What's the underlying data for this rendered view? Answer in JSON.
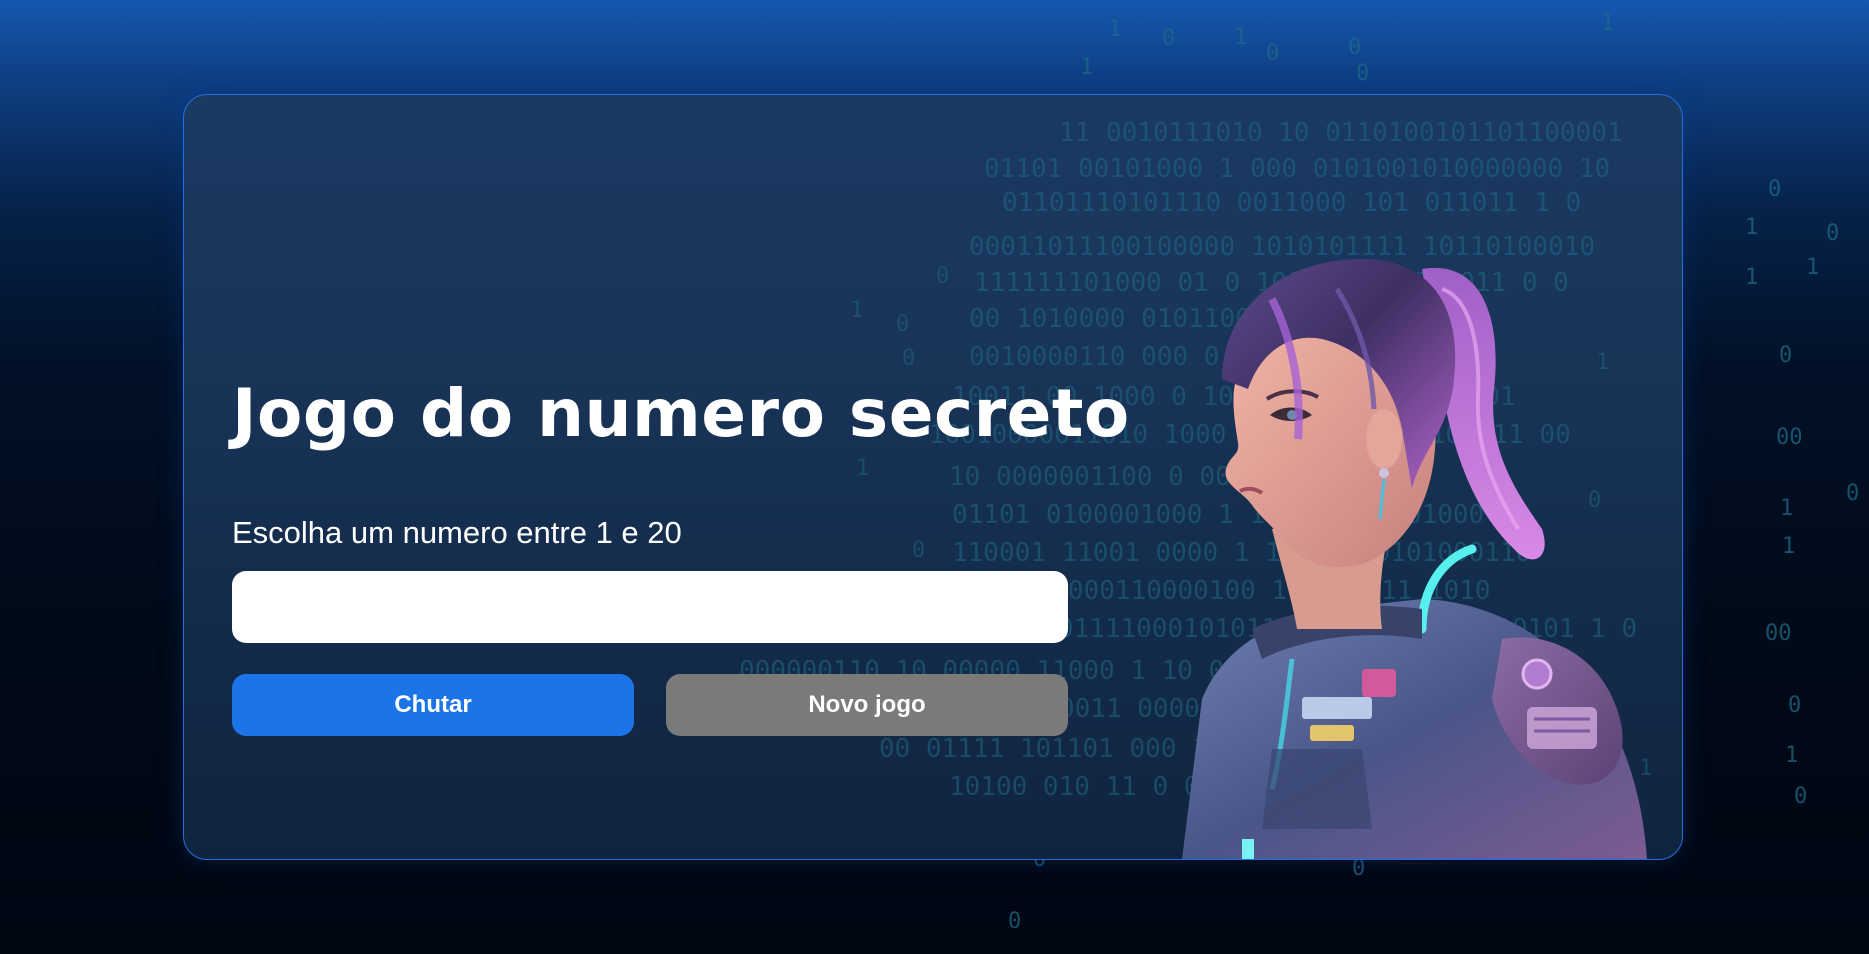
{
  "game": {
    "title": "Jogo do numero secreto",
    "prompt": "Escolha um numero entre 1 e 20",
    "guess_input": {
      "value": "",
      "placeholder": ""
    },
    "buttons": {
      "guess_label": "Chutar",
      "new_game_label": "Novo jogo"
    }
  },
  "colors": {
    "accent": "#1b75e8",
    "secondary_button": "#7a7a7a",
    "card_border": "#1f6fe0",
    "binary_rain": "#1f6a86"
  },
  "decor": {
    "background": "binary-rain",
    "illustration": "cyberpunk-astronaut-girl-portrait"
  }
}
